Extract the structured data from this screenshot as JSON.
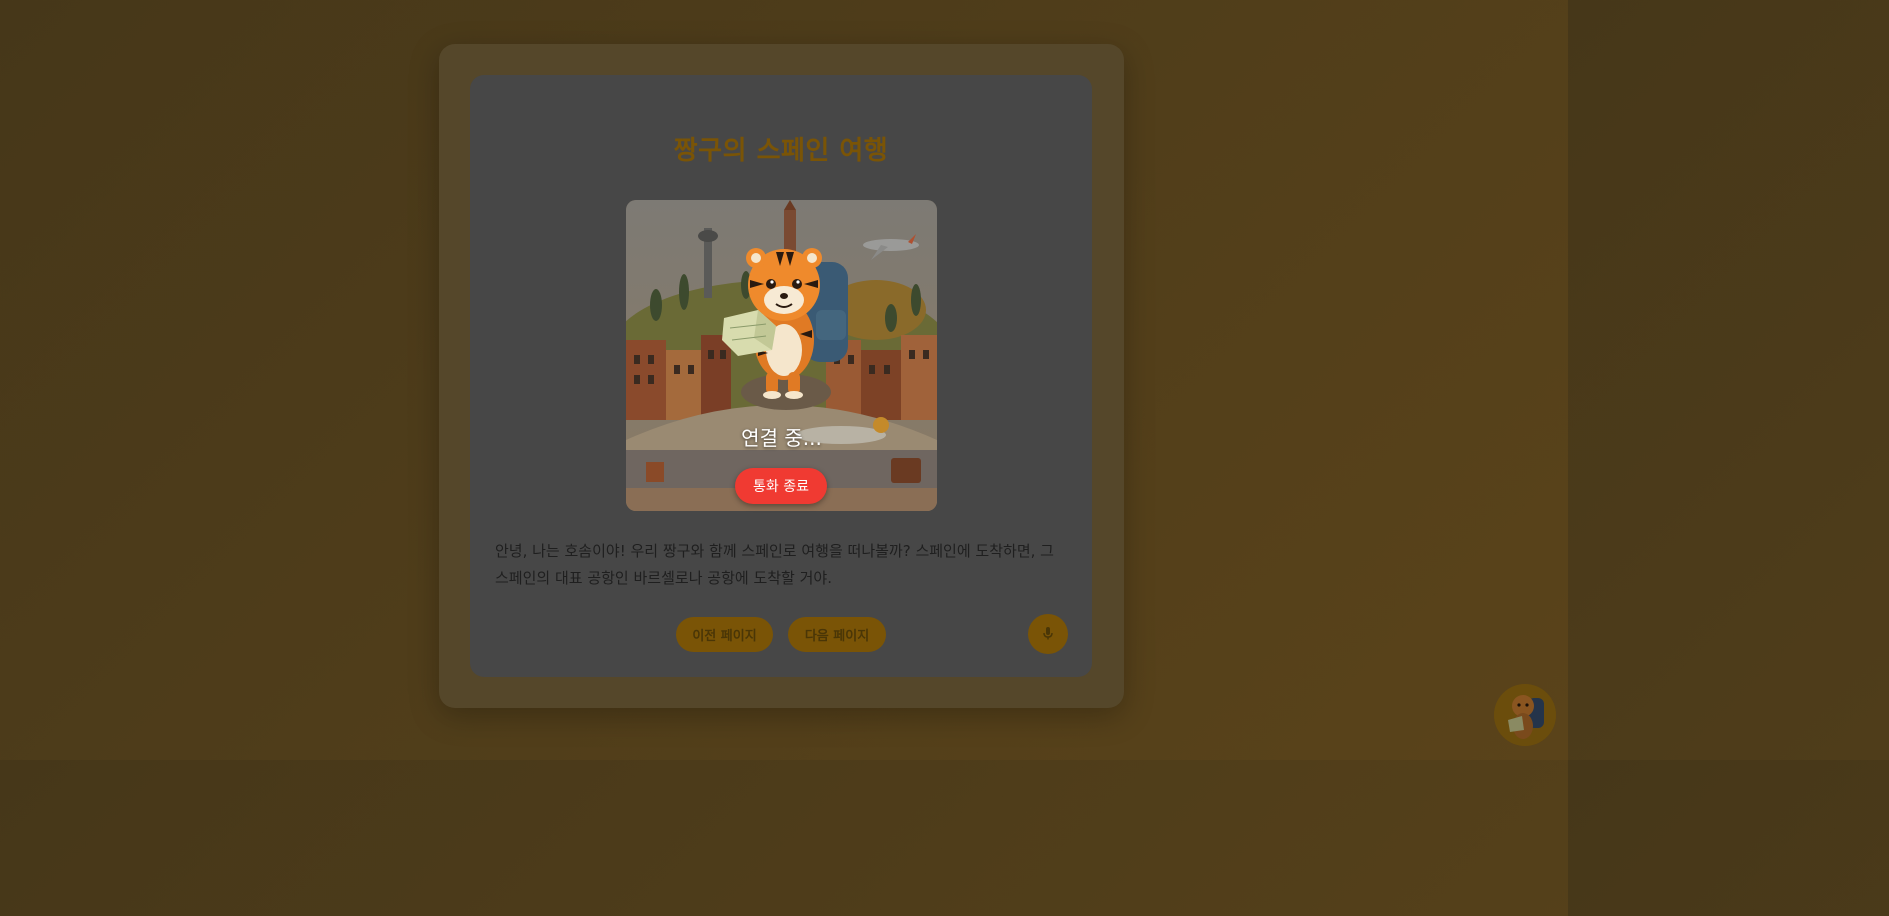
{
  "story": {
    "title": "짱구의 스페인 여행",
    "body": "안녕, 나는 호솜이야! 우리 짱구와 함께 스페인로 여행을 떠나볼까? 스페인에 도착하면, 그 스페인의 대표 공항인 바르셀로나 공항에 도착할 거야."
  },
  "call": {
    "status": "연결 중...",
    "end_label": "통화 종료"
  },
  "nav": {
    "prev_label": "이전 페이지",
    "next_label": "다음 페이지"
  },
  "icons": {
    "mic": "microphone-icon",
    "avatar": "tiger-avatar-icon"
  },
  "colors": {
    "accent": "#7a5406",
    "end_call": "#f03a32"
  }
}
